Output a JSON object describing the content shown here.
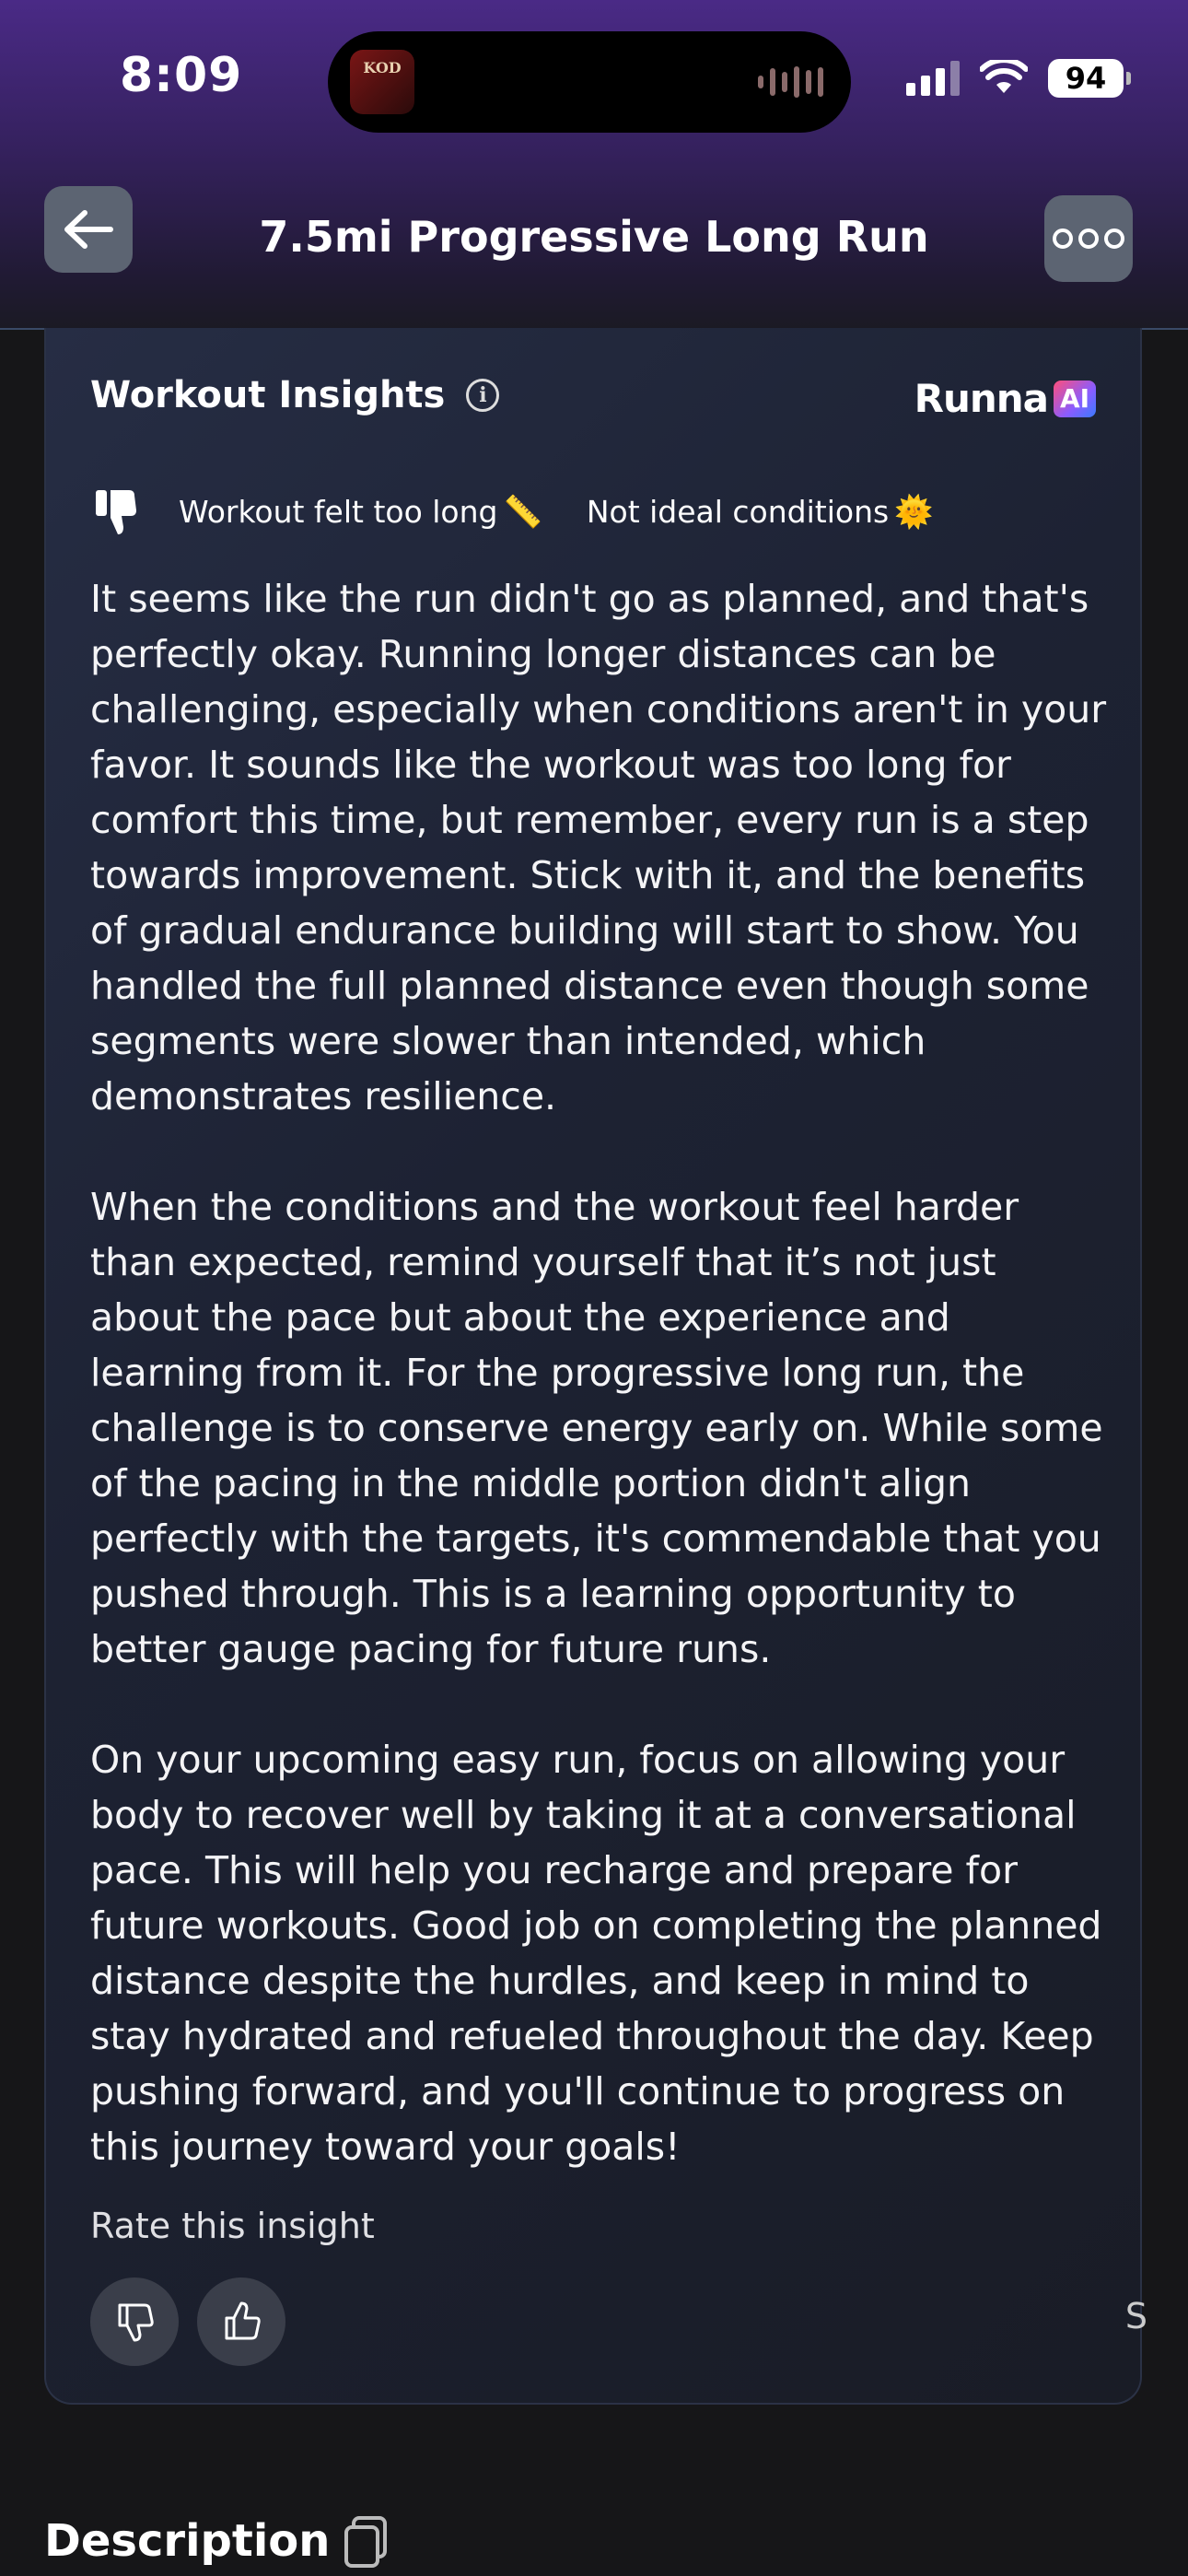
{
  "status_bar": {
    "time": "8:09",
    "battery": "94",
    "now_playing_art_text": "KOD"
  },
  "header": {
    "title": "7.5mi Progressive Long Run",
    "back_icon": "arrow-left-icon",
    "more_icon": "ellipsis-icon"
  },
  "insights": {
    "title": "Workout Insights",
    "brand_name": "Runna",
    "brand_badge": "AI",
    "feedback_rating_icon": "thumbs-down-filled-icon",
    "feedback_tags": [
      {
        "label": "Workout felt too long",
        "emoji": "📏"
      },
      {
        "label": "Not ideal conditions",
        "emoji": "🌞"
      }
    ],
    "paragraphs": [
      "It seems like the run didn't go as planned, and that's perfectly okay. Running longer distances can be challenging, especially when conditions aren't in your favor. It sounds like the workout was too long for comfort this time, but remember, every run is a step towards improvement. Stick with it, and the benefits of gradual endurance building will start to show. You handled the full planned distance even though some segments were slower than intended, which demonstrates resilience.",
      "When the conditions and the workout feel harder than expected, remind yourself that it’s not just about the pace but about the experience and learning from it. For the progressive long run, the challenge is to conserve energy early on. While some of the pacing in the middle portion didn't align perfectly with the targets, it's commendable that you pushed through. This is a learning opportunity to better gauge pacing for future runs.",
      "On your upcoming easy run, focus on allowing your body to recover well by taking it at a conversational pace. This will help you recharge and prepare for future workouts. Good job on completing the planned distance despite the hurdles, and keep in mind to stay hydrated and refueled throughout the day. Keep pushing forward, and you'll continue to progress on this journey toward your goals!"
    ],
    "rate_label": "Rate this insight",
    "edge_partial_text": "S"
  },
  "description": {
    "title": "Description"
  },
  "colors": {
    "header_purple": "#4a2a86",
    "background": "#161618",
    "card": "#1d2233"
  }
}
